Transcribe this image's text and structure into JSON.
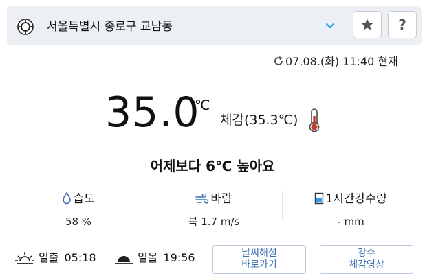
{
  "location": {
    "name": "서울특별시 종로구 교남동",
    "icons": {
      "locate": "crosshair-icon",
      "dropdown": "chevron-down-icon"
    }
  },
  "toolbar": {
    "favorite_icon": "star-icon",
    "help_label": "?"
  },
  "updated": {
    "icon": "refresh-icon",
    "text": "07.08.(화) 11:40 현재"
  },
  "current": {
    "temperature": "35.0",
    "unit": "℃",
    "feels_like": "체감(35.3℃)",
    "compare_yesterday": "어제보다 6℃ 높아요"
  },
  "stats": {
    "humidity": {
      "label": "습도",
      "value": "58 %",
      "icon": "droplet-icon"
    },
    "wind": {
      "label": "바람",
      "value": "북 1.7 m/s",
      "icon": "wind-icon"
    },
    "rain": {
      "label": "1시간강수량",
      "value": "- mm",
      "icon": "rain-gauge-icon"
    }
  },
  "sun": {
    "sunrise_label": "일출",
    "sunrise_time": "05:18",
    "sunset_label": "일몰",
    "sunset_time": "19:56"
  },
  "links": {
    "commentary_line1": "날씨해설",
    "commentary_line2": "바로가기",
    "precip_line1": "강수",
    "precip_line2": "체감영상"
  },
  "colors": {
    "accent_blue": "#3b6fb6",
    "thermometer_red": "#c0392b",
    "chevron_blue": "#2a9df4",
    "bar_bg": "#eceff3"
  }
}
